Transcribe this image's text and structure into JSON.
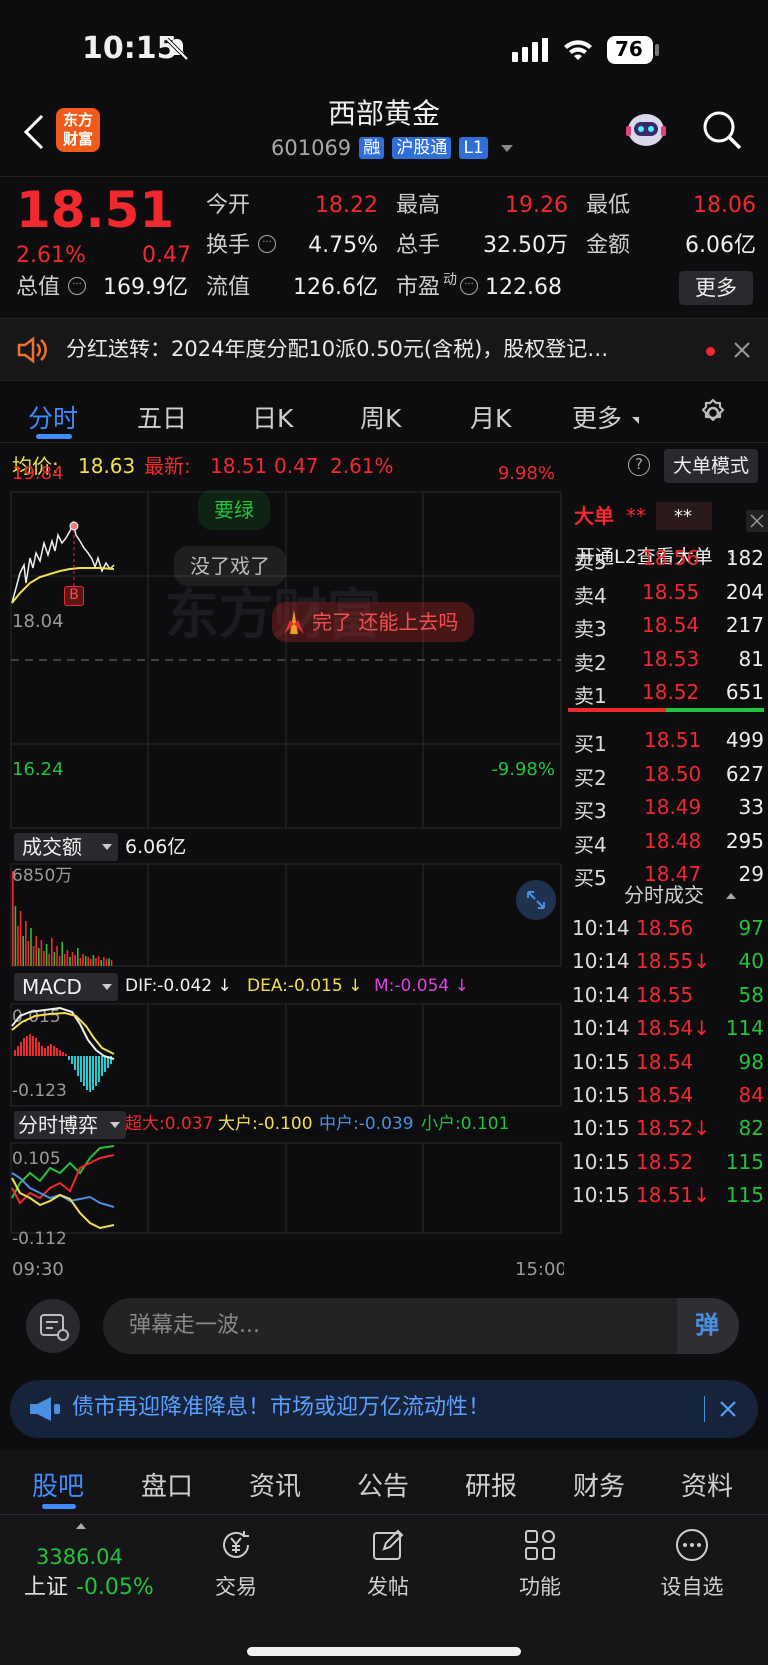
{
  "status_bar": {
    "time": "10:15",
    "battery": "76"
  },
  "header": {
    "back_icon": "chevron-left-icon",
    "app_logo": "东方\n财富",
    "stock_name": "西部黄金",
    "stock_code": "601069",
    "badges": [
      "融",
      "沪股通",
      "L1"
    ],
    "robot_icon": "robot-assistant-icon",
    "search_icon": "search-icon"
  },
  "quote": {
    "price": "18.51",
    "change_pct": "2.61%",
    "change": "0.47",
    "open_label": "今开",
    "open": "18.22",
    "high_label": "最高",
    "high": "19.26",
    "low_label": "最低",
    "low": "18.06",
    "turnover_label": "换手",
    "turnover": "4.75%",
    "volume_label": "总手",
    "volume": "32.50万",
    "amount_label": "金额",
    "amount": "6.06亿",
    "mktcap_label": "总值",
    "mktcap": "169.9亿",
    "float_label": "流值",
    "float": "126.6亿",
    "pe_label": "市盈",
    "pe_sup": "动",
    "pe": "122.68",
    "more_label": "更多"
  },
  "notice": {
    "text": "分红送转：2024年度分配10派0.50元(含税)，股权登记…"
  },
  "tabs": [
    "分时",
    "五日",
    "日K",
    "周K",
    "月K",
    "更多"
  ],
  "info_line": {
    "avg_label": "均价:",
    "avg": "18.63",
    "last_label": "最新:",
    "last": "18.51",
    "chg": "0.47",
    "pct": "2.61%",
    "mode_button": "大单模式"
  },
  "price_chart": {
    "y_top": "19.84",
    "y_mid": "18.04",
    "y_bottom": "16.24",
    "pct_top": "9.98%",
    "pct_bottom": "-9.98%",
    "b_marker": "B",
    "danmaku": [
      "要绿",
      "没了戏了",
      "完了 还能上去吗"
    ],
    "watermark": "东方财富"
  },
  "volume_panel": {
    "selector": "成交额",
    "total": "6.06亿",
    "max": "6850万"
  },
  "macd_panel": {
    "selector": "MACD",
    "dif": "DIF:-0.042 ↓",
    "dea": "DEA:-0.015 ↓",
    "m": "M:-0.054 ↓",
    "top": "0.015",
    "bottom": "-0.123"
  },
  "game_panel": {
    "selector": "分时博弈",
    "super": "超大:0.037",
    "big": "大户:-0.100",
    "mid": "中户:-0.039",
    "small": "小户:0.101",
    "top": "0.105",
    "bottom": "-0.112"
  },
  "time_axis": {
    "start": "09:30",
    "end": "15:00"
  },
  "order_book": {
    "big_order_label": "大单",
    "big_order_mask": "**",
    "big_order_mask2": "**",
    "l2_prompt": "开通L2查看大单",
    "asks": [
      {
        "label": "卖5",
        "price": "18.56",
        "vol": "182"
      },
      {
        "label": "卖4",
        "price": "18.55",
        "vol": "204"
      },
      {
        "label": "卖3",
        "price": "18.54",
        "vol": "217"
      },
      {
        "label": "卖2",
        "price": "18.53",
        "vol": "81"
      },
      {
        "label": "卖1",
        "price": "18.52",
        "vol": "651"
      }
    ],
    "bids": [
      {
        "label": "买1",
        "price": "18.51",
        "vol": "499"
      },
      {
        "label": "买2",
        "price": "18.50",
        "vol": "627"
      },
      {
        "label": "买3",
        "price": "18.49",
        "vol": "33"
      },
      {
        "label": "买4",
        "price": "18.48",
        "vol": "295"
      },
      {
        "label": "买5",
        "price": "18.47",
        "vol": "29"
      }
    ],
    "ticks_title": "分时成交",
    "ticks": [
      {
        "time": "10:14",
        "price": "18.56",
        "vol": "97",
        "vol_color": "green"
      },
      {
        "time": "10:14",
        "price": "18.55↓",
        "vol": "40",
        "vol_color": "green"
      },
      {
        "time": "10:14",
        "price": "18.55",
        "vol": "58",
        "vol_color": "green"
      },
      {
        "time": "10:14",
        "price": "18.54↓",
        "vol": "114",
        "vol_color": "green"
      },
      {
        "time": "10:15",
        "price": "18.54",
        "vol": "98",
        "vol_color": "green"
      },
      {
        "time": "10:15",
        "price": "18.54",
        "vol": "84",
        "vol_color": "red"
      },
      {
        "time": "10:15",
        "price": "18.52↓",
        "vol": "82",
        "vol_color": "green"
      },
      {
        "time": "10:15",
        "price": "18.52",
        "vol": "115",
        "vol_color": "green"
      },
      {
        "time": "10:15",
        "price": "18.51↓",
        "vol": "115",
        "vol_color": "green"
      }
    ]
  },
  "danmaku_input": {
    "placeholder": "弹幕走一波...",
    "send_label": "弹"
  },
  "ad": {
    "text": "债市再迎降准降息！市场或迎万亿流动性！"
  },
  "bottom_tabs": [
    "股吧",
    "盘口",
    "资讯",
    "公告",
    "研报",
    "财务",
    "资料"
  ],
  "tabbar": {
    "index_value": "3386.04",
    "index_name": "上证",
    "index_change": "-0.05%",
    "items": [
      "交易",
      "发帖",
      "功能",
      "设自选"
    ]
  },
  "colors": {
    "up": "#f0292e",
    "down": "#22c33a",
    "accent": "#3f8cff",
    "background": "#0d0d0f"
  }
}
